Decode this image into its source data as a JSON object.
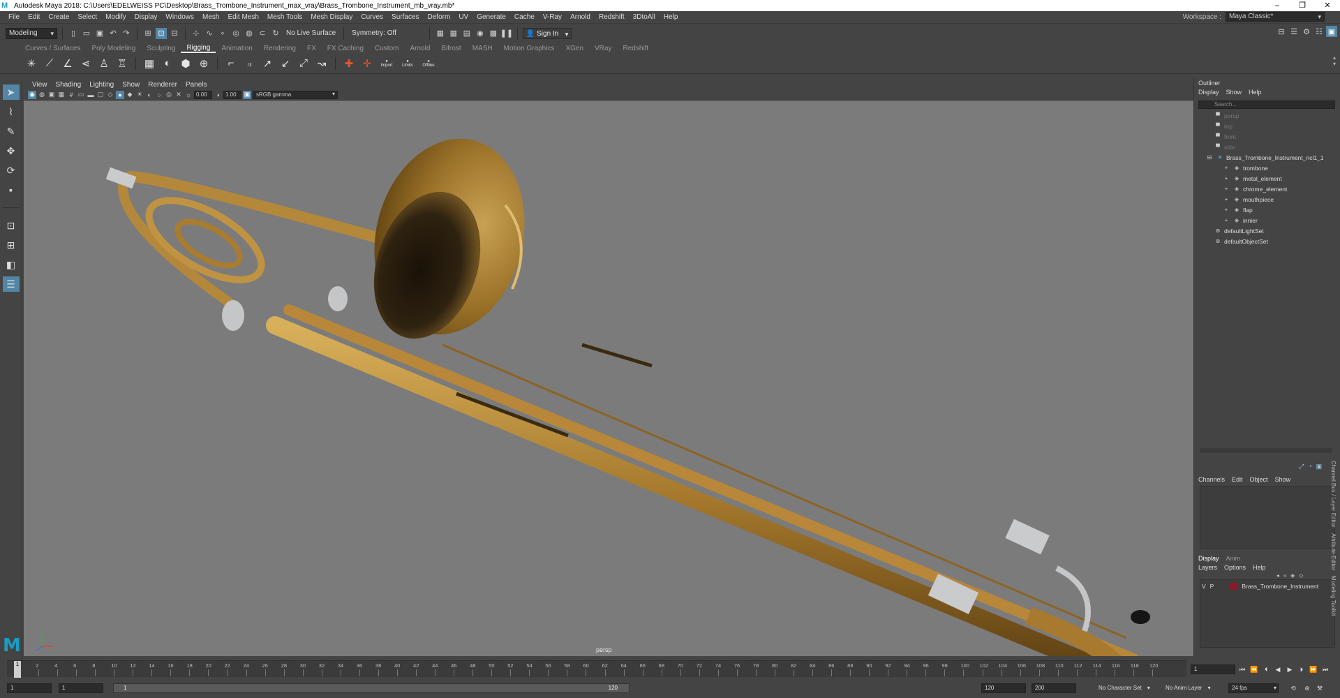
{
  "window": {
    "title": "Autodesk Maya 2018: C:\\Users\\EDELWEISS PC\\Desktop\\Brass_Trombone_Instrument_max_vray\\Brass_Trombone_Instrument_mb_vray.mb*",
    "minimize": "–",
    "maximize": "❐",
    "close": "✕"
  },
  "menubar": [
    "File",
    "Edit",
    "Create",
    "Select",
    "Modify",
    "Display",
    "Windows",
    "Mesh",
    "Edit Mesh",
    "Mesh Tools",
    "Mesh Display",
    "Curves",
    "Surfaces",
    "Deform",
    "UV",
    "Generate",
    "Cache",
    "V-Ray",
    "Arnold",
    "Redshift",
    "3DtoAll",
    "Help"
  ],
  "workspace": {
    "label": "Workspace :",
    "value": "Maya Classic*"
  },
  "statusline": {
    "mode": "Modeling",
    "live_surface": "No Live Surface",
    "symmetry": "Symmetry: Off",
    "sign_in": "Sign In"
  },
  "shelf": {
    "tabs": [
      "Curves / Surfaces",
      "Poly Modeling",
      "Sculpting",
      "Rigging",
      "Animation",
      "Rendering",
      "FX",
      "FX Caching",
      "Custom",
      "Arnold",
      "Bifrost",
      "MASH",
      "Motion Graphics",
      "XGen",
      "VRay",
      "Redshift"
    ],
    "active_tab": "Rigging",
    "labels": [
      "Import",
      "Limits",
      "Offline"
    ]
  },
  "viewport": {
    "menu": [
      "View",
      "Shading",
      "Lighting",
      "Show",
      "Renderer",
      "Panels"
    ],
    "exposure": "0.00",
    "gamma": "1.00",
    "color_space": "sRGB gamma",
    "camera": "persp"
  },
  "outliner": {
    "title": "Outliner",
    "menu": [
      "Display",
      "Show",
      "Help"
    ],
    "search_placeholder": "Search...",
    "items": [
      {
        "label": "persp",
        "icon": "camera-icon",
        "dim": true,
        "indent": 1
      },
      {
        "label": "top",
        "icon": "camera-icon",
        "dim": true,
        "indent": 1
      },
      {
        "label": "front",
        "icon": "camera-icon",
        "dim": true,
        "indent": 1
      },
      {
        "label": "side",
        "icon": "camera-icon",
        "dim": true,
        "indent": 1
      },
      {
        "label": "Brass_Trombone_Instrument_ncl1_1",
        "icon": "group-icon",
        "dim": false,
        "indent": 0
      },
      {
        "label": "trombone",
        "icon": "mesh-icon",
        "dim": false,
        "indent": 2
      },
      {
        "label": "metal_element",
        "icon": "mesh-icon",
        "dim": false,
        "indent": 2
      },
      {
        "label": "chrome_element",
        "icon": "mesh-icon",
        "dim": false,
        "indent": 2
      },
      {
        "label": "mouthpiece",
        "icon": "mesh-icon",
        "dim": false,
        "indent": 2
      },
      {
        "label": "flap",
        "icon": "mesh-icon",
        "dim": false,
        "indent": 2
      },
      {
        "label": "innier",
        "icon": "mesh-icon",
        "dim": false,
        "indent": 2
      },
      {
        "label": "defaultLightSet",
        "icon": "set-icon",
        "dim": false,
        "indent": 1
      },
      {
        "label": "defaultObjectSet",
        "icon": "set-icon",
        "dim": false,
        "indent": 1
      }
    ]
  },
  "channelbox": {
    "menu": [
      "Channels",
      "Edit",
      "Object",
      "Show"
    ]
  },
  "layers": {
    "tabs": [
      "Display",
      "Anim"
    ],
    "menu": [
      "Layers",
      "Options",
      "Help"
    ],
    "row": {
      "v": "V",
      "p": "P",
      "name": "Brass_Trombone_Instrument",
      "color": "#8b1a2a"
    }
  },
  "sidetabs": [
    "Channel Box / Layer Editor",
    "Attribute Editor",
    "Modeling Toolkit"
  ],
  "timeline": {
    "ticks": [
      "2",
      "4",
      "6",
      "8",
      "10",
      "12",
      "14",
      "16",
      "18",
      "20",
      "22",
      "24",
      "26",
      "28",
      "30",
      "32",
      "34",
      "36",
      "38",
      "40",
      "42",
      "44",
      "46",
      "48",
      "50",
      "52",
      "54",
      "56",
      "58",
      "60",
      "62",
      "64",
      "66",
      "68",
      "70",
      "72",
      "74",
      "76",
      "78",
      "80",
      "82",
      "84",
      "86",
      "88",
      "90",
      "92",
      "94",
      "96",
      "98",
      "100",
      "102",
      "104",
      "106",
      "108",
      "110",
      "112",
      "114",
      "116",
      "118",
      "120"
    ],
    "playhead": "1",
    "current_frame": "1"
  },
  "range": {
    "start": "1",
    "anim_start": "1",
    "slider_start": "1",
    "slider_end": "120",
    "end": "120",
    "anim_end": "200",
    "character_set": "No Character Set",
    "anim_layer": "No Anim Layer",
    "fps": "24 fps"
  }
}
